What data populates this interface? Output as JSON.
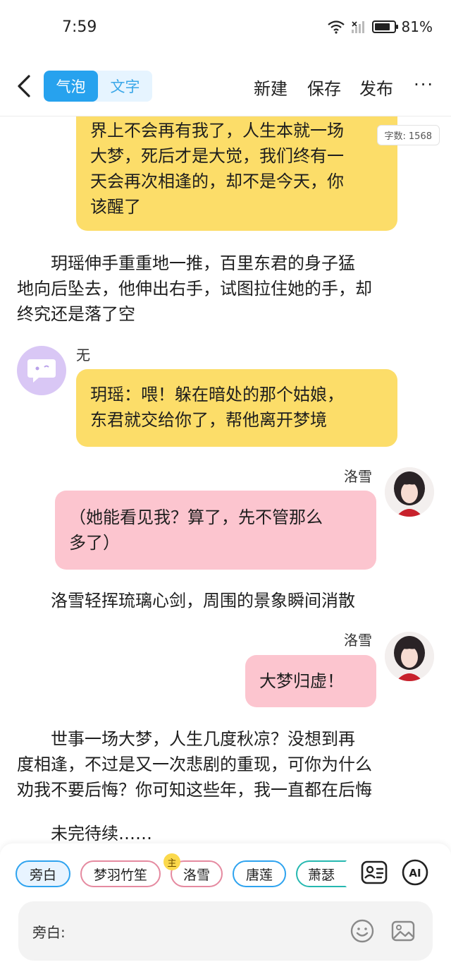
{
  "status_bar": {
    "time": "7:59",
    "battery": "81%",
    "battery_level": 0.81
  },
  "toolbar": {
    "modes": [
      {
        "label": "气泡",
        "active": true
      },
      {
        "label": "文字",
        "active": false
      }
    ],
    "new_label": "新建",
    "save_label": "保存",
    "publish_label": "发布",
    "more_label": "···"
  },
  "word_count": {
    "label": "字数:",
    "value": "1568"
  },
  "messages": [
    {
      "type": "bubble",
      "lines": [
        "界上不会再有我了，人生本就一场",
        "大梦，死后才是大觉，我们终有一",
        "天会再次相逢的，却不是今天，你",
        "该醒了"
      ]
    },
    {
      "type": "narration",
      "lines": [
        "　　玥瑶伸手重重地一推，百里东君的身子猛",
        "地向后坠去，他伸出右手，试图拉住她的手，却",
        "终究还是落了空"
      ]
    },
    {
      "type": "bubble",
      "speaker": "无",
      "lines": [
        "玥瑶：喂！躲在暗处的那个姑娘，",
        "东君就交给你了，帮他离开梦境"
      ]
    },
    {
      "type": "bubble",
      "speaker": "洛雪",
      "lines": [
        "（她能看见我？算了，先不管那么",
        "多了）"
      ]
    },
    {
      "type": "narration",
      "lines": [
        "　　洛雪轻挥琉璃心剑，周围的景象瞬间消散"
      ]
    },
    {
      "type": "bubble",
      "speaker": "洛雪",
      "lines": [
        "大梦归虚！"
      ]
    },
    {
      "type": "narration",
      "lines": [
        "　　世事一场大梦，人生几度秋凉？没想到再",
        "度相逢，不过是又一次悲剧的重现，可你为什么",
        "劝我不要后悔？你可知这些年，我一直都在后悔"
      ]
    },
    {
      "type": "narration",
      "lines": [
        "　　未完待续……"
      ]
    }
  ],
  "roles": [
    {
      "label": "旁白",
      "color": "#2ea3ef",
      "active": true
    },
    {
      "label": "梦羽竹笙",
      "color": "#e58aa0"
    },
    {
      "label": "洛雪",
      "color": "#e58aa0",
      "badge": "主"
    },
    {
      "label": "唐莲",
      "color": "#2ea3ef"
    },
    {
      "label": "萧瑟",
      "color": "#25b8b0"
    }
  ],
  "icons": {
    "role_card": "role-card-icon",
    "ai": "AI",
    "emoji": "emoji-icon",
    "image": "image-icon"
  },
  "input": {
    "label": "旁白:"
  }
}
